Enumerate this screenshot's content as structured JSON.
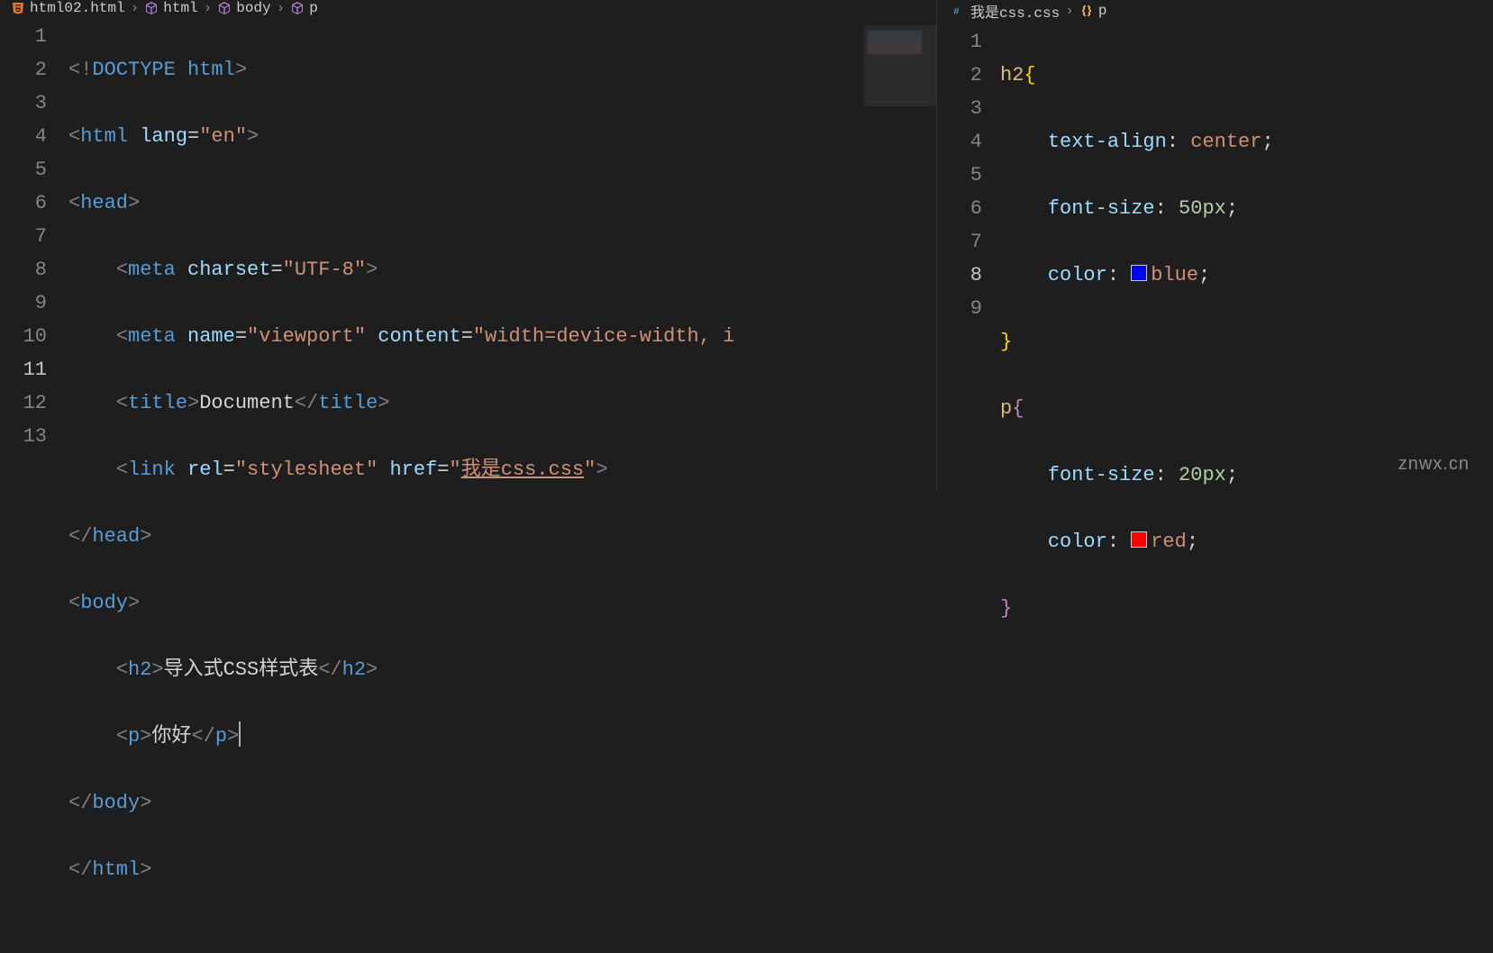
{
  "left": {
    "breadcrumb": {
      "file": "html02.html",
      "segments": [
        "html",
        "body",
        "p"
      ]
    },
    "lines": [
      "1",
      "2",
      "3",
      "4",
      "5",
      "6",
      "7",
      "8",
      "9",
      "10",
      "11",
      "12",
      "13"
    ],
    "activeLine": "11",
    "code": {
      "l1": {
        "doctype_open": "<!",
        "doctype": "DOCTYPE",
        "sp": " ",
        "html": "html",
        "gt": ">"
      },
      "l2": {
        "lt": "<",
        "tag": "html",
        "sp": " ",
        "attr": "lang",
        "eq": "=",
        "val": "\"en\"",
        "gt": ">"
      },
      "l3": {
        "lt": "<",
        "tag": "head",
        "gt": ">"
      },
      "l4": {
        "lt": "<",
        "tag": "meta",
        "sp": " ",
        "attr": "charset",
        "eq": "=",
        "val": "\"UTF-8\"",
        "gt": ">"
      },
      "l5": {
        "lt": "<",
        "tag": "meta",
        "sp": " ",
        "attr1": "name",
        "eq": "=",
        "val1": "\"viewport\"",
        "sp2": " ",
        "attr2": "content",
        "val2": "\"width=device-width, i",
        "gt": ""
      },
      "l6": {
        "lt": "<",
        "tag": "title",
        "gt": ">",
        "text": "Document",
        "lt2": "</",
        "tag2": "title",
        "gt2": ">"
      },
      "l7": {
        "lt": "<",
        "tag": "link",
        "sp": " ",
        "attr1": "rel",
        "eq": "=",
        "val1": "\"stylesheet\"",
        "sp2": " ",
        "attr2": "href",
        "val2a": "\"",
        "val2b": "我是css.css",
        "val2c": "\"",
        "gt": ">"
      },
      "l8": {
        "lt": "</",
        "tag": "head",
        "gt": ">"
      },
      "l9": {
        "lt": "<",
        "tag": "body",
        "gt": ">"
      },
      "l10": {
        "lt": "<",
        "tag": "h2",
        "gt": ">",
        "text": "导入式CSS样式表",
        "lt2": "</",
        "tag2": "h2",
        "gt2": ">"
      },
      "l11": {
        "lt": "<",
        "tag": "p",
        "gt": ">",
        "text": "你好",
        "lt2": "</",
        "tag2": "p",
        "gt2": ">"
      },
      "l12": {
        "lt": "</",
        "tag": "body",
        "gt": ">"
      },
      "l13": {
        "lt": "</",
        "tag": "html",
        "gt": ">"
      }
    }
  },
  "right": {
    "breadcrumb": {
      "file": "我是css.css",
      "segment": "p"
    },
    "lines": [
      "1",
      "2",
      "3",
      "4",
      "5",
      "6",
      "7",
      "8",
      "9"
    ],
    "activeLine": "8",
    "code": {
      "l1": {
        "sel": "h2",
        "brace": "{"
      },
      "l2": {
        "prop": "text-align",
        "colon": ": ",
        "val": "center",
        "semi": ";"
      },
      "l3": {
        "prop": "font-size",
        "colon": ": ",
        "num": "50",
        "unit": "px",
        "semi": ";"
      },
      "l4": {
        "prop": "color",
        "colon": ": ",
        "swatch": "#0000ff",
        "val": "blue",
        "semi": ";"
      },
      "l5": {
        "brace": "}"
      },
      "l6": {
        "sel": "p",
        "brace": "{"
      },
      "l7": {
        "prop": "font-size",
        "colon": ": ",
        "num": "20",
        "unit": "px",
        "semi": ";"
      },
      "l8": {
        "prop": "color",
        "colon": ": ",
        "swatch": "#ff0000",
        "val": "red",
        "semi": ";"
      },
      "l9": {
        "brace": "}"
      }
    }
  },
  "watermark": "znwx.cn"
}
